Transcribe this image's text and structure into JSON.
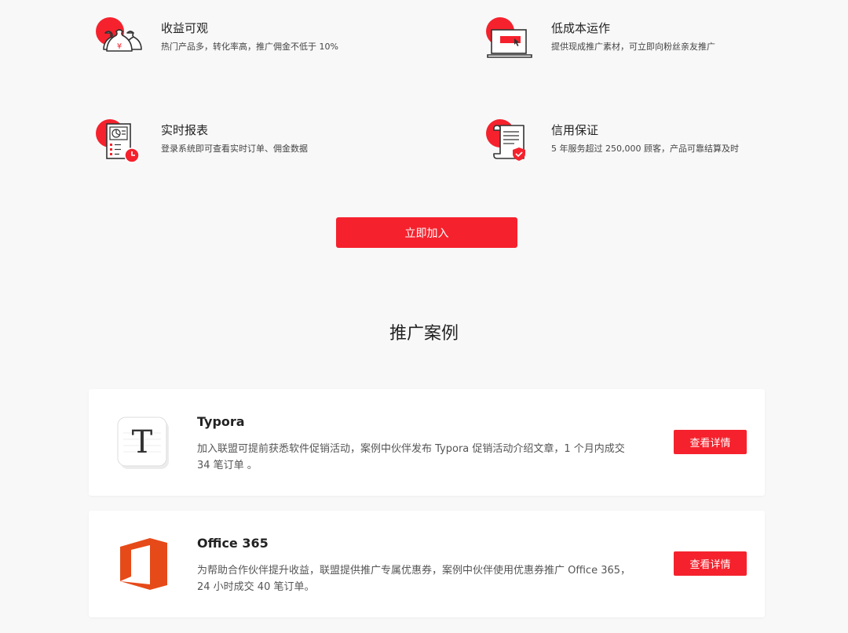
{
  "features": [
    {
      "title": "收益可观",
      "desc": "热门产品多，转化率高，推广佣金不低于 10%",
      "icon": "money-bags-icon"
    },
    {
      "title": "低成本运作",
      "desc": "提供现成推广素材，可立即向粉丝亲友推广",
      "icon": "laptop-icon"
    },
    {
      "title": "实时报表",
      "desc": "登录系统即可查看实时订单、佣金数据",
      "icon": "report-icon"
    },
    {
      "title": "信用保证",
      "desc": "5 年服务超过 250,000 顾客，产品可靠结算及时",
      "icon": "certificate-icon"
    }
  ],
  "join_button": "立即加入",
  "cases_title": "推广案例",
  "cases": [
    {
      "name": "Typora",
      "text": "加入联盟可提前获悉软件促销活动，案例中伙伴发布 Typora 促销活动介绍文章，1 个月内成交 34 笔订单 。",
      "button": "查看详情",
      "logo": "typora-logo-icon"
    },
    {
      "name": "Office 365",
      "text": "为帮助合作伙伴提升收益，联盟提供推广专属优惠券，案例中伙伴使用优惠券推广 Office 365，24 小时成交 40 笔订单。",
      "button": "查看详情",
      "logo": "office-logo-icon"
    }
  ],
  "colors": {
    "accent": "#f5222d",
    "background": "#f8f8f8",
    "card": "#ffffff",
    "office": "#e64a19"
  }
}
